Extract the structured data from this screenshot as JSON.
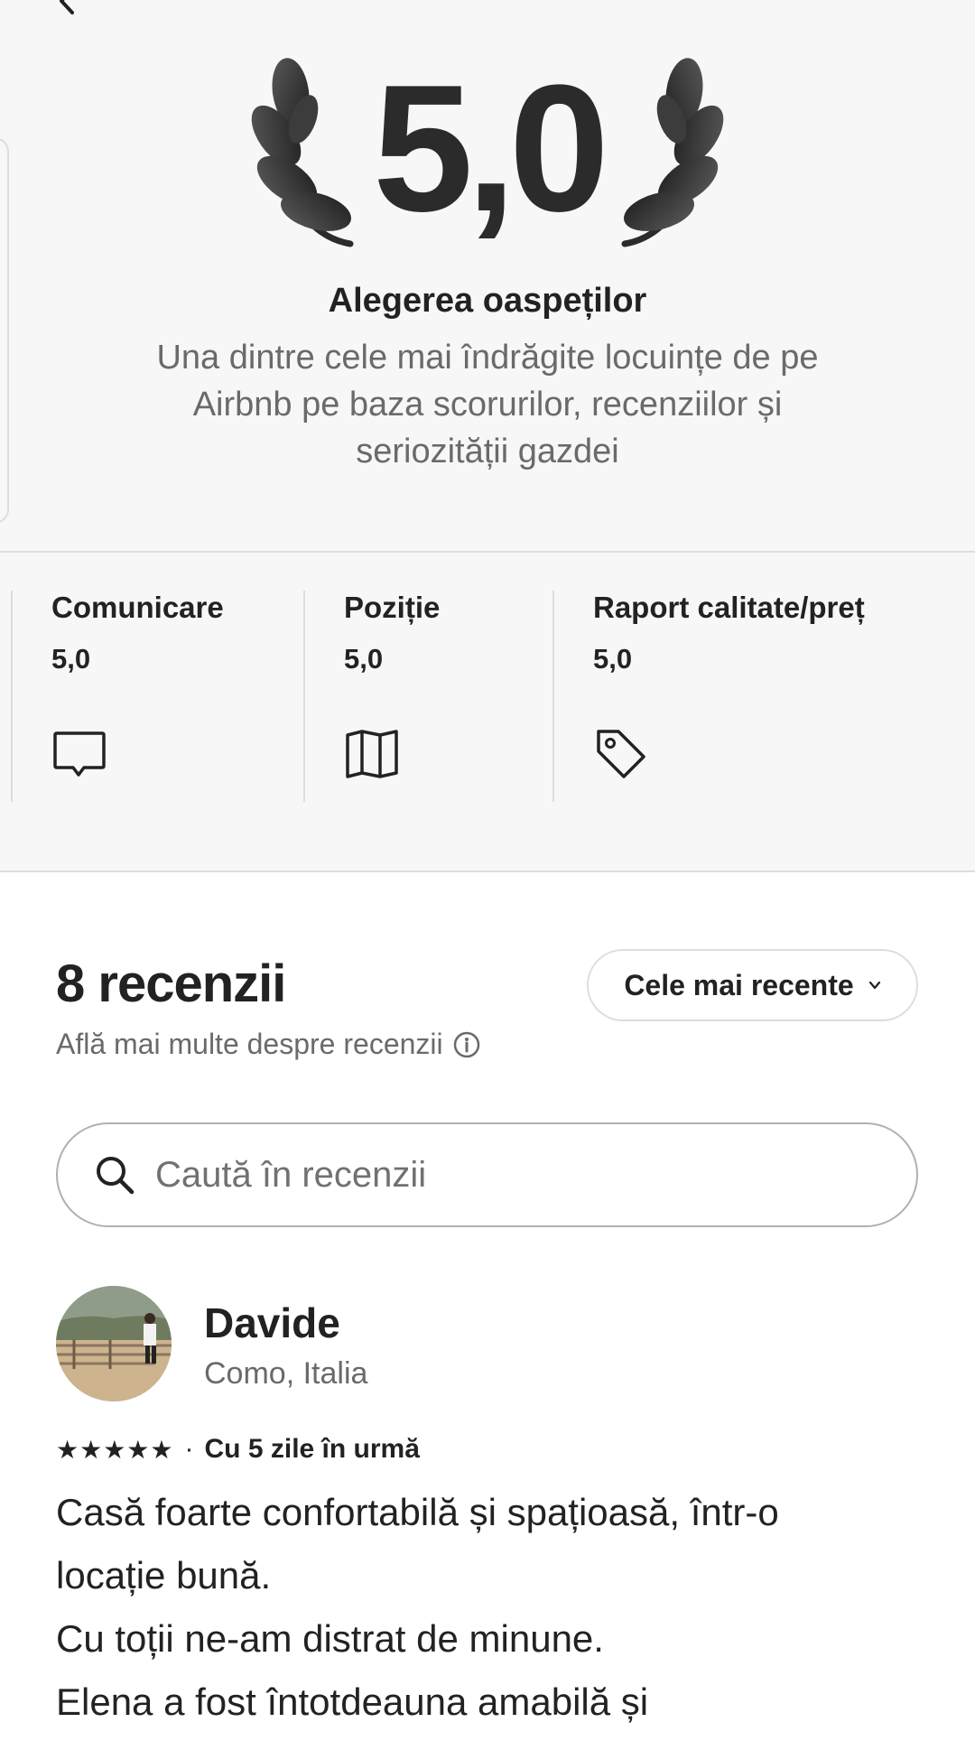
{
  "hero": {
    "score": "5,0",
    "title": "Alegerea oaspeților",
    "description": "Una dintre cele mai îndrăgite locuințe de pe Airbnb pe baza scorurilor, recenziilor și seriozității gazdei"
  },
  "categories": [
    {
      "label": "Comunicare",
      "value": "5,0",
      "icon": "chat-bubble-icon"
    },
    {
      "label": "Poziție",
      "value": "5,0",
      "icon": "map-icon"
    },
    {
      "label": "Raport calitate/preț",
      "value": "5,0",
      "icon": "price-tag-icon"
    }
  ],
  "reviews": {
    "count_label": "8 recenzii",
    "learn_more": "Află mai multe despre recenzii",
    "sort_label": "Cele mai recente",
    "search_placeholder": "Caută în recenzii"
  },
  "review": {
    "name": "Davide",
    "location": "Como, Italia",
    "stars": "★★★★★",
    "rating": 5,
    "date": "Cu 5 zile în urmă",
    "lines": [
      "Casă foarte confortabilă și spațioasă, într-o",
      "locație bună.",
      "Cu toții ne-am distrat de minune.",
      "Elena a fost întotdeauna amabilă și"
    ]
  },
  "colors": {
    "section_bg": "#f7f7f7",
    "text_primary": "#222222",
    "text_secondary": "#6a6a6a",
    "divider": "#dddddd"
  }
}
